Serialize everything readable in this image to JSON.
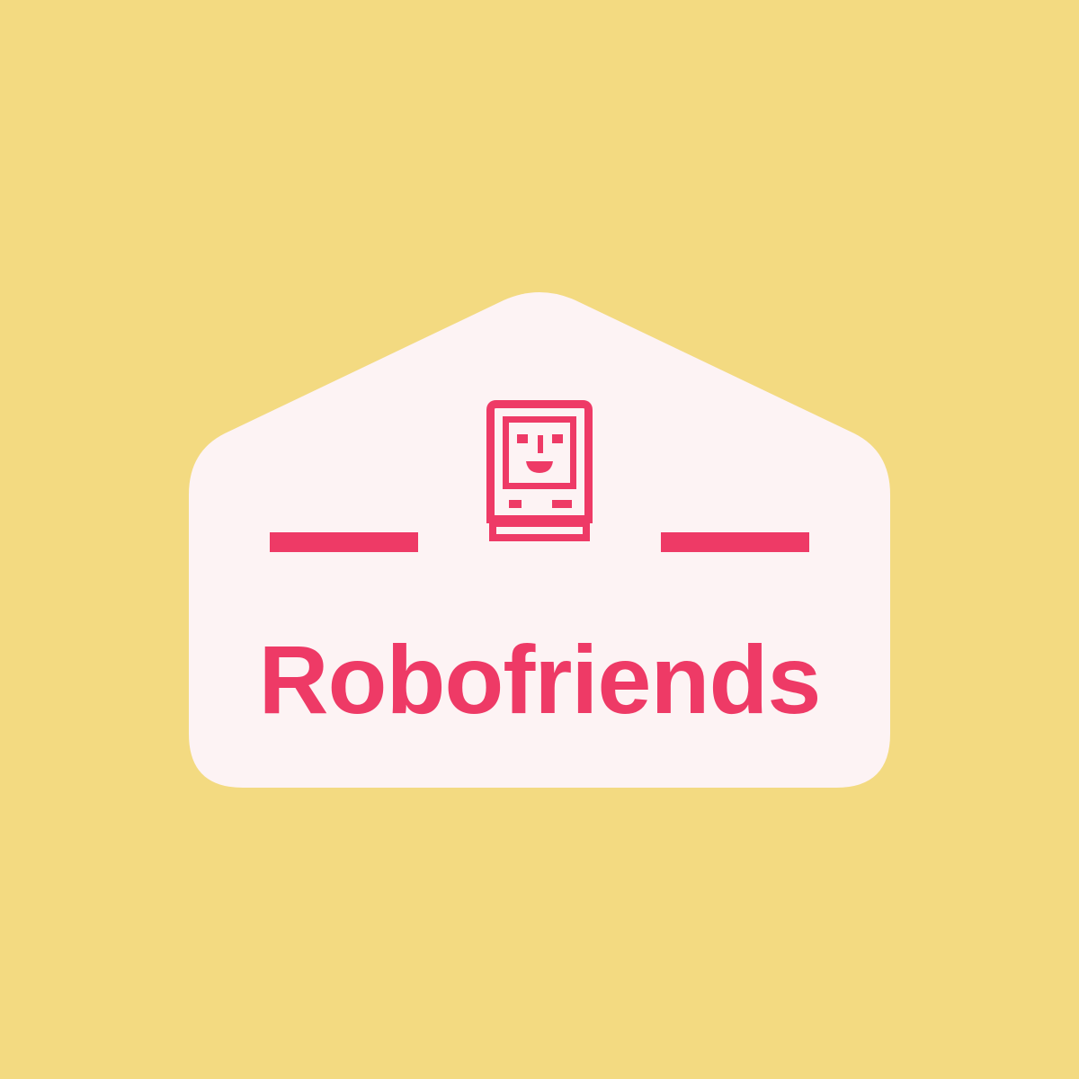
{
  "brand": {
    "name": "Robofriends"
  },
  "icons": {
    "mascot": "retro-computer-face-icon"
  },
  "colors": {
    "background": "#f3da81",
    "badge": "#fdf3f4",
    "accent": "#ee3a66"
  }
}
